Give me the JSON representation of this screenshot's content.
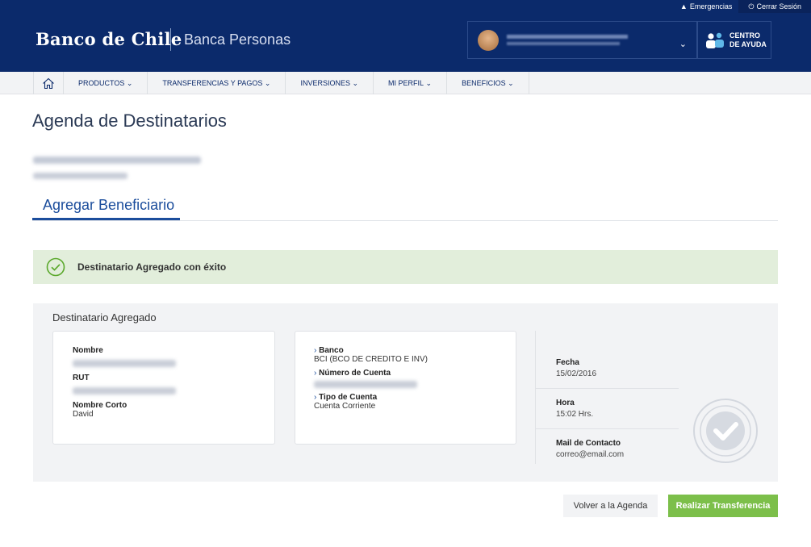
{
  "header": {
    "top_links": {
      "emergencias": "Emergencias",
      "logout": "Cerrar Sesión"
    },
    "logo": "Banco de Chile",
    "subtitle": "Banca Personas",
    "help": "CENTRO\nDE AYUDA",
    "colors": {
      "header_bg": "#0b2a6b",
      "accent": "#1b4d9c",
      "success_bg": "#e2eedb",
      "primary_button": "#7cbf4a"
    }
  },
  "nav": {
    "home_icon": "home-icon",
    "items": [
      {
        "label": "PRODUCTOS"
      },
      {
        "label": "TRANSFERENCIAS Y PAGOS"
      },
      {
        "label": "INVERSIONES"
      },
      {
        "label": "MI PERFIL"
      },
      {
        "label": "BENEFICIOS"
      }
    ]
  },
  "page": {
    "title": "Agenda de Destinatarios",
    "tab": "Agregar Beneficiario"
  },
  "alert": {
    "icon": "check-circle-icon",
    "message": "Destinatario Agregado con éxito"
  },
  "summary": {
    "title": "Destinatario Agregado",
    "recipient": {
      "name_label": "Nombre",
      "rut_label": "RUT",
      "short_name_label": "Nombre Corto",
      "short_name": "David"
    },
    "account": {
      "bank_label": "Banco",
      "bank": "BCI (BCO DE CREDITO E INV)",
      "account_number_label": "Número de Cuenta",
      "account_type_label": "Tipo de Cuenta",
      "account_type": "Cuenta Corriente"
    },
    "details": {
      "date_label": "Fecha",
      "date": "15/02/2016",
      "time_label": "Hora",
      "time": "15:02 Hrs.",
      "mail_label": "Mail de Contacto",
      "mail": "correo@email.com"
    }
  },
  "actions": {
    "back": "Volver a la Agenda",
    "transfer": "Realizar Transferencia"
  }
}
